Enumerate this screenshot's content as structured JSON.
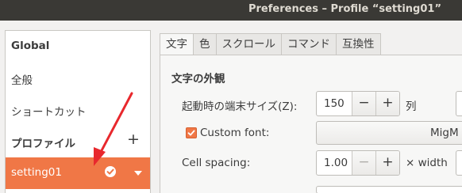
{
  "window": {
    "title": "Preferences – Profile “setting01”"
  },
  "sidebar": {
    "items": [
      {
        "label": "Global"
      },
      {
        "label": "全般"
      },
      {
        "label": "ショートカット"
      },
      {
        "label": "プロファイル",
        "add_icon": "+"
      },
      {
        "label": "setting01",
        "status_icon": "check-icon",
        "menu_icon": "caret-down-icon"
      }
    ]
  },
  "tabs": [
    {
      "label": "文字"
    },
    {
      "label": "色"
    },
    {
      "label": "スクロール"
    },
    {
      "label": "コマンド"
    },
    {
      "label": "互換性"
    }
  ],
  "panel": {
    "section_title": "文字の外観",
    "initial_size_label": "起動時の端末サイズ(Z):",
    "columns_value": "150",
    "columns_unit": "列",
    "custom_font_label": "Custom font:",
    "custom_font_checked": true,
    "font_button_text": "MigM",
    "cell_spacing_label": "Cell spacing:",
    "cell_spacing_value": "1.00",
    "cell_spacing_unit": "× width",
    "minus_label": "−",
    "plus_label": "+"
  },
  "colors": {
    "accent": "#f07746",
    "annotation_arrow": "#e8282d",
    "titlebar": "#3a3935"
  }
}
